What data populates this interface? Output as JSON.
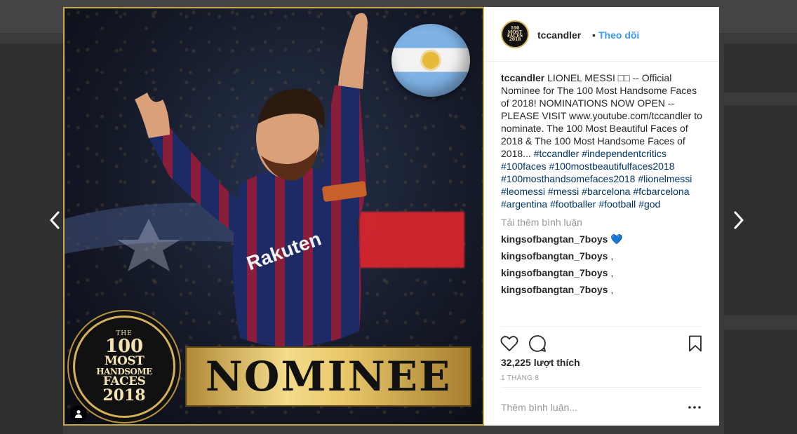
{
  "post": {
    "username": "tccandler",
    "separator": "•",
    "follow_label": "Theo dõi",
    "image": {
      "nominee_label": "NOMINEE",
      "seal_lines": [
        "THE",
        "100",
        "MOST",
        "HANDSOME",
        "FACES",
        "2018"
      ],
      "jersey_text": "Rakuten"
    },
    "caption": {
      "username": "tccandler",
      "text": "LIONEL MESSI □□ -- Official Nominee for The 100 Most Handsome Faces of 2018! NOMINATIONS NOW OPEN -- PLEASE VISIT www.youtube.com/tccandler to nominate. The 100 Most Beautiful Faces of 2018 & The 100 Most Handsome Faces of 2018...",
      "hashtags": [
        "#tccandler",
        "#independentcritics",
        "#100faces",
        "#100mostbeautifulfaces2018",
        "#100mosthandsomefaces2018",
        "#lionelmessi",
        "#leomessi",
        "#messi",
        "#barcelona",
        "#fcbarcelona",
        "#argentina",
        "#footballer",
        "#football",
        "#god"
      ]
    },
    "load_more_label": "Tải thêm bình luận",
    "comments": [
      {
        "user": "kingsofbangtan_7boys",
        "text": "💙"
      },
      {
        "user": "kingsofbangtan_7boys",
        "text": ","
      },
      {
        "user": "kingsofbangtan_7boys",
        "text": ","
      },
      {
        "user": "kingsofbangtan_7boys",
        "text": ","
      }
    ],
    "likes_label": "32,225 lượt thích",
    "date_label": "1 THÁNG 8",
    "comment_placeholder": "Thêm bình luận...",
    "more_label": "•••"
  },
  "icons": {
    "prev": "chevron-left-icon",
    "next": "chevron-right-icon",
    "like": "heart-icon",
    "comment": "comment-bubble-icon",
    "save": "bookmark-icon",
    "user_tag": "user-tag-icon"
  },
  "colors": {
    "link_blue": "#3897f0",
    "hashtag": "#003569",
    "muted": "#999999",
    "gold": "#d4b15a"
  }
}
